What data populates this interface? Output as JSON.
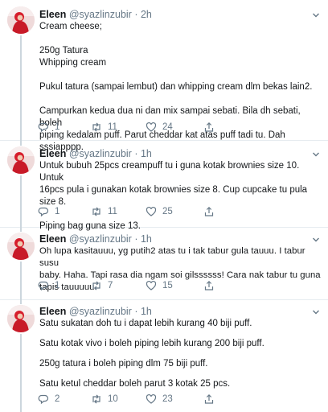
{
  "colors": {
    "accent": "#1da1f2",
    "muted": "#657786",
    "divider": "#e6ecf0",
    "text": "#14171a"
  },
  "tweets": [
    {
      "name": "Eleen",
      "handle": "@syazlinzubir",
      "sep": "·",
      "time": "2h",
      "lines": [
        "Cream cheese;",
        "",
        "250g Tatura",
        "Whipping cream",
        "",
        "Pukul tatura (sampai lembut) dan whipping cream dlm bekas lain2.",
        "",
        "Campurkan kedua dua ni dan mix sampai sebati. Bila dh sebati, boleh",
        "piping kedalam puff. Parut cheddar kat atas puff tadi tu. Dah sssiapppp."
      ],
      "replies": "1",
      "retweets": "11",
      "likes": "24"
    },
    {
      "name": "Eleen",
      "handle": "@syazlinzubir",
      "sep": "·",
      "time": "1h",
      "lines": [
        "Untuk bubuh 25pcs creampuff tu i guna kotak brownies size 10. Untuk",
        "16pcs pula i gunakan kotak brownies size 8. Cup cupcake tu pula size 8.",
        "",
        "Piping bag guna size 13."
      ],
      "replies": "1",
      "retweets": "11",
      "likes": "25"
    },
    {
      "name": "Eleen",
      "handle": "@syazlinzubir",
      "sep": "·",
      "time": "1h",
      "lines": [
        "Oh lupa kasitauuu, yg putih2 atas tu i tak tabur gula tauuu. I tabur susu",
        "baby. Haha. Tapi rasa dia ngam soi gilssssss! Cara nak tabur tu guna",
        "tapis tauuuuu."
      ],
      "replies": "1",
      "retweets": "7",
      "likes": "15"
    },
    {
      "name": "Eleen",
      "handle": "@syazlinzubir",
      "sep": "·",
      "time": "1h",
      "lines": [
        "Satu sukatan doh tu i dapat lebih kurang 40 biji puff.",
        "",
        "Satu kotak vivo i boleh piping lebih kurang 200 biji puff.",
        "",
        "250g tatura i boleh piping dlm 75 biji puff.",
        "",
        "Satu ketul cheddar boleh parut 3 kotak 25 pcs."
      ],
      "replies": "2",
      "retweets": "10",
      "likes": "23"
    }
  ]
}
